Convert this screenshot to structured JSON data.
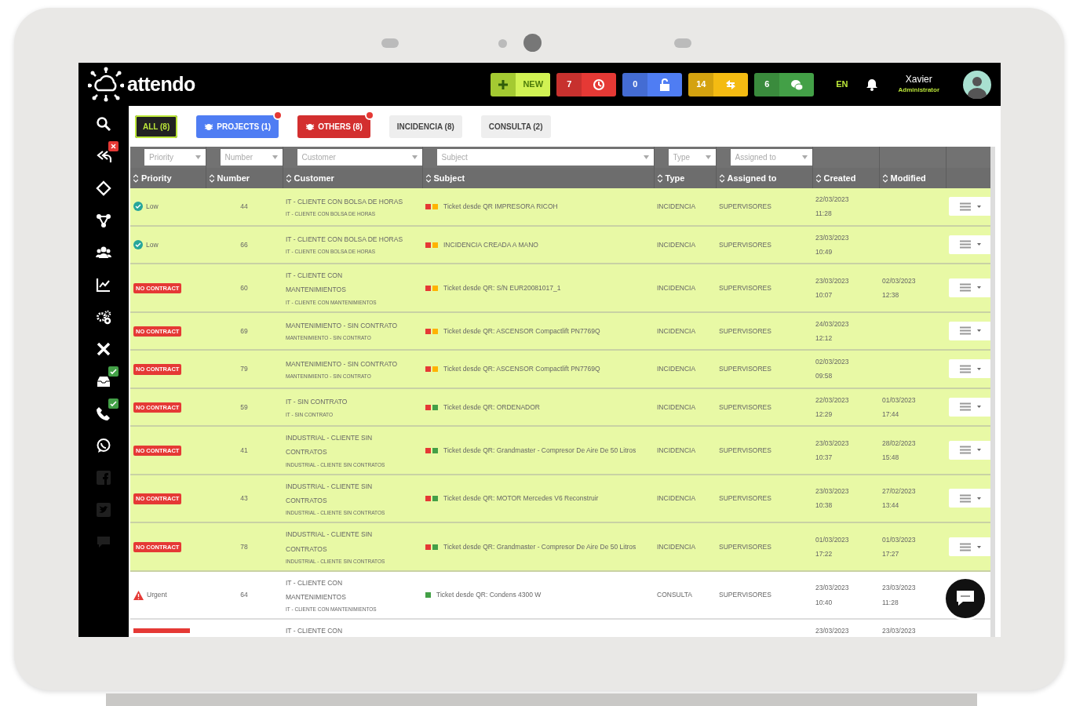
{
  "topbar": {
    "logo": "attendo",
    "new_button": {
      "label": "NEW"
    },
    "counters": [
      {
        "count": "7",
        "color": "#e53935"
      },
      {
        "count": "0",
        "color": "#4f7df3"
      },
      {
        "count": "14",
        "color": "#f4bb12"
      },
      {
        "count": "6",
        "color": "#43a047"
      }
    ],
    "language": "EN",
    "user": {
      "name": "Xavier",
      "role": "Administrator"
    }
  },
  "sidebar": {
    "items": [
      {
        "dimmed": false
      },
      {
        "dimmed": false,
        "badge": {
          "kind": "cross",
          "color": "#e53935"
        }
      },
      {
        "dimmed": false
      },
      {
        "dimmed": false
      },
      {
        "dimmed": false
      },
      {
        "dimmed": false
      },
      {
        "dimmed": false
      },
      {
        "dimmed": false
      },
      {
        "dimmed": false,
        "badge": {
          "kind": "check",
          "color": "#43a047"
        }
      },
      {
        "dimmed": false,
        "badge": {
          "kind": "check",
          "color": "#43a047"
        }
      },
      {
        "dimmed": false
      },
      {
        "dimmed": true
      },
      {
        "dimmed": true
      },
      {
        "dimmed": true
      }
    ]
  },
  "tabs": [
    {
      "label": "ALL (8)",
      "kind": "dark",
      "selected": true,
      "notification": false
    },
    {
      "label": "PROJECTS (1)",
      "kind": "blue",
      "selected": false,
      "notification": true
    },
    {
      "label": "OTHERS (8)",
      "kind": "red",
      "selected": false,
      "notification": true
    },
    {
      "label": "INCIDENCIA (8)",
      "kind": "plain",
      "selected": false,
      "notification": false
    },
    {
      "label": "CONSULTA (2)",
      "kind": "plain",
      "selected": false,
      "notification": false
    }
  ],
  "table": {
    "filters": [
      {
        "placeholder": "Priority"
      },
      {
        "placeholder": "Number"
      },
      {
        "placeholder": "Customer"
      },
      {
        "placeholder": "Subject"
      },
      {
        "placeholder": "Type"
      },
      {
        "placeholder": "Assigned to"
      }
    ],
    "columns": [
      "Priority",
      "Number",
      "Customer",
      "Subject",
      "Type",
      "Assigned to",
      "Created",
      "Modified"
    ],
    "rows": [
      {
        "highlighted": true,
        "priority": {
          "kind": "low",
          "label": "Low"
        },
        "number": "44",
        "customer": [
          "IT - CLIENTE CON BOLSA DE HORAS"
        ],
        "customer_sub": "IT - CLIENTE CON BOLSA DE HORAS",
        "dots": [
          {
            "color": "#e53935"
          },
          {
            "color": "#ffb300"
          }
        ],
        "subject": "Ticket desde QR IMPRESORA RICOH",
        "type": "INCIDENCIA",
        "assigned": "SUPERVISORES",
        "created": [
          "22/03/2023",
          "11:28"
        ],
        "menu_button": true
      },
      {
        "highlighted": true,
        "priority": {
          "kind": "low",
          "label": "Low"
        },
        "number": "66",
        "customer": [
          "IT - CLIENTE CON BOLSA DE HORAS"
        ],
        "customer_sub": "IT - CLIENTE CON BOLSA DE HORAS",
        "dots": [
          {
            "color": "#e53935"
          },
          {
            "color": "#ffb300"
          }
        ],
        "subject": "INCIDENCIA CREADA A MANO",
        "type": "INCIDENCIA",
        "assigned": "SUPERVISORES",
        "created": [
          "23/03/2023",
          "10:49"
        ],
        "menu_button": true
      },
      {
        "highlighted": true,
        "priority": {
          "kind": "no_contract",
          "label": "NO CONTRACT"
        },
        "number": "60",
        "customer": [
          "IT - CLIENTE CON",
          "MANTENIMIENTOS"
        ],
        "customer_sub": "IT - CLIENTE CON MANTENIMIENTOS",
        "dots": [
          {
            "color": "#e53935"
          },
          {
            "color": "#ffb300"
          }
        ],
        "subject": "Ticket desde QR: S/N EUR20081017_1",
        "type": "INCIDENCIA",
        "assigned": "SUPERVISORES",
        "created": [
          "23/03/2023",
          "10:07"
        ],
        "modified": [
          "02/03/2023",
          "12:38"
        ],
        "menu_button": true
      },
      {
        "highlighted": true,
        "priority": {
          "kind": "no_contract",
          "label": "NO CONTRACT"
        },
        "number": "69",
        "customer": [
          "MANTENIMIENTO - SIN CONTRATO"
        ],
        "customer_sub": "MANTENIMIENTO - SIN CONTRATO",
        "dots": [
          {
            "color": "#e53935"
          },
          {
            "color": "#ffb300"
          }
        ],
        "subject": "Ticket desde QR: ASCENSOR Compactlift PN7769Q",
        "type": "INCIDENCIA",
        "assigned": "SUPERVISORES",
        "created": [
          "24/03/2023",
          "12:12"
        ],
        "menu_button": true
      },
      {
        "highlighted": true,
        "priority": {
          "kind": "no_contract",
          "label": "NO CONTRACT"
        },
        "number": "79",
        "customer": [
          "MANTENIMIENTO - SIN CONTRATO"
        ],
        "customer_sub": "MANTENIMIENTO - SIN CONTRATO",
        "dots": [
          {
            "color": "#e53935"
          },
          {
            "color": "#ffb300"
          }
        ],
        "subject": "Ticket desde QR: ASCENSOR Compactlift PN7769Q",
        "type": "INCIDENCIA",
        "assigned": "SUPERVISORES",
        "created": [
          "02/03/2023",
          "09:58"
        ],
        "menu_button": true
      },
      {
        "highlighted": true,
        "priority": {
          "kind": "no_contract",
          "label": "NO CONTRACT"
        },
        "number": "59",
        "customer": [
          "IT - SIN CONTRATO"
        ],
        "customer_sub": "IT - SIN CONTRATO",
        "dots": [
          {
            "color": "#e53935"
          },
          {
            "color": "#43a047"
          }
        ],
        "subject": "Ticket desde QR: ORDENADOR",
        "type": "INCIDENCIA",
        "assigned": "SUPERVISORES",
        "created": [
          "22/03/2023",
          "12:29"
        ],
        "modified": [
          "01/03/2023",
          "17:44"
        ],
        "menu_button": true
      },
      {
        "highlighted": true,
        "priority": {
          "kind": "no_contract",
          "label": "NO CONTRACT"
        },
        "number": "41",
        "customer": [
          "INDUSTRIAL - CLIENTE SIN",
          "CONTRATOS"
        ],
        "customer_sub": "INDUSTRIAL - CLIENTE SIN CONTRATOS",
        "dots": [
          {
            "color": "#e53935"
          },
          {
            "color": "#43a047"
          }
        ],
        "subject": "Ticket desde QR: Grandmaster - Compresor De Aire De 50 Litros",
        "type": "INCIDENCIA",
        "assigned": "SUPERVISORES",
        "created": [
          "23/03/2023",
          "10:37"
        ],
        "modified": [
          "28/02/2023",
          "15:48"
        ],
        "menu_button": true
      },
      {
        "highlighted": true,
        "priority": {
          "kind": "no_contract",
          "label": "NO CONTRACT"
        },
        "number": "43",
        "customer": [
          "INDUSTRIAL - CLIENTE SIN",
          "CONTRATOS"
        ],
        "customer_sub": "INDUSTRIAL - CLIENTE SIN CONTRATOS",
        "dots": [
          {
            "color": "#e53935"
          },
          {
            "color": "#43a047"
          }
        ],
        "subject": "Ticket desde QR: MOTOR Mercedes V6 Reconstruir",
        "type": "INCIDENCIA",
        "assigned": "SUPERVISORES",
        "created": [
          "23/03/2023",
          "10:38"
        ],
        "modified": [
          "27/02/2023",
          "13:44"
        ],
        "menu_button": true
      },
      {
        "highlighted": true,
        "priority": {
          "kind": "no_contract",
          "label": "NO CONTRACT"
        },
        "number": "78",
        "customer": [
          "INDUSTRIAL - CLIENTE SIN",
          "CONTRATOS"
        ],
        "customer_sub": "INDUSTRIAL - CLIENTE SIN CONTRATOS",
        "dots": [
          {
            "color": "#e53935"
          },
          {
            "color": "#43a047"
          }
        ],
        "subject": "Ticket desde QR: Grandmaster - Compresor De Aire De 50 Litros",
        "type": "INCIDENCIA",
        "assigned": "SUPERVISORES",
        "created": [
          "01/03/2023",
          "17:22"
        ],
        "modified": [
          "01/03/2023",
          "17:27"
        ],
        "menu_button": true
      },
      {
        "highlighted": false,
        "priority": {
          "kind": "urgent",
          "label": "Urgent"
        },
        "number": "64",
        "customer": [
          "IT - CLIENTE CON",
          "MANTENIMIENTOS"
        ],
        "customer_sub": "IT - CLIENTE CON MANTENIMIENTOS",
        "dots": [
          {
            "color": "#43a047"
          }
        ],
        "subject": "Ticket desde QR: Condens 4300 W",
        "type": "CONSULTA",
        "assigned": "SUPERVISORES",
        "created": [
          "23/03/2023",
          "10:40"
        ],
        "modified": [
          "23/03/2023",
          "11:28"
        ],
        "menu_button": false
      },
      {
        "highlighted": false,
        "priority": {
          "kind": "bar"
        },
        "customer": [
          "IT - CLIENTE CON"
        ],
        "created": [
          "23/03/2023"
        ],
        "modified": [
          "23/03/2023"
        ],
        "menu_button": false
      }
    ]
  }
}
